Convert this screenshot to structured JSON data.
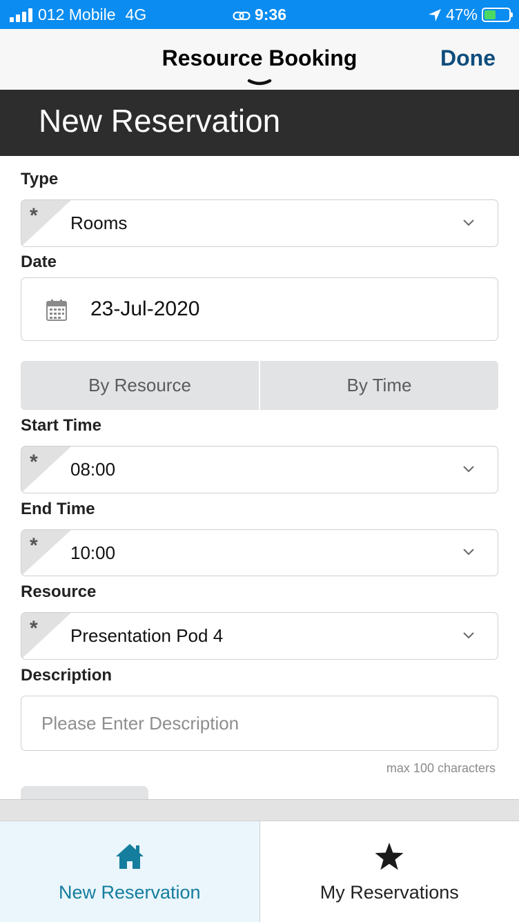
{
  "status_bar": {
    "carrier": "012 Mobile",
    "network": "4G",
    "time": "9:36",
    "battery": "47%",
    "battery_level": 0.47,
    "background_color": "#0a8cf0"
  },
  "nav": {
    "title": "Resource Booking",
    "done_label": "Done"
  },
  "header": {
    "title": "New Reservation"
  },
  "form": {
    "type": {
      "label": "Type",
      "value": "Rooms",
      "required_mark": "*"
    },
    "date": {
      "label": "Date",
      "value": "23-Jul-2020",
      "icon": "calendar-icon"
    },
    "mode_toggle": {
      "options": [
        "By Resource",
        "By Time"
      ]
    },
    "start_time": {
      "label": "Start Time",
      "value": "08:00",
      "required_mark": "*"
    },
    "end_time": {
      "label": "End Time",
      "value": "10:00",
      "required_mark": "*"
    },
    "resource": {
      "label": "Resource",
      "value": "Presentation Pod 4",
      "required_mark": "*"
    },
    "description": {
      "label": "Description",
      "placeholder": "Please Enter Description",
      "hint": "max 100 characters"
    }
  },
  "tab_bar": {
    "tabs": [
      {
        "label": "New Reservation",
        "icon": "home-icon",
        "active": true
      },
      {
        "label": "My Reservations",
        "icon": "star-icon",
        "active": false
      }
    ],
    "active_color": "#157d9e"
  }
}
